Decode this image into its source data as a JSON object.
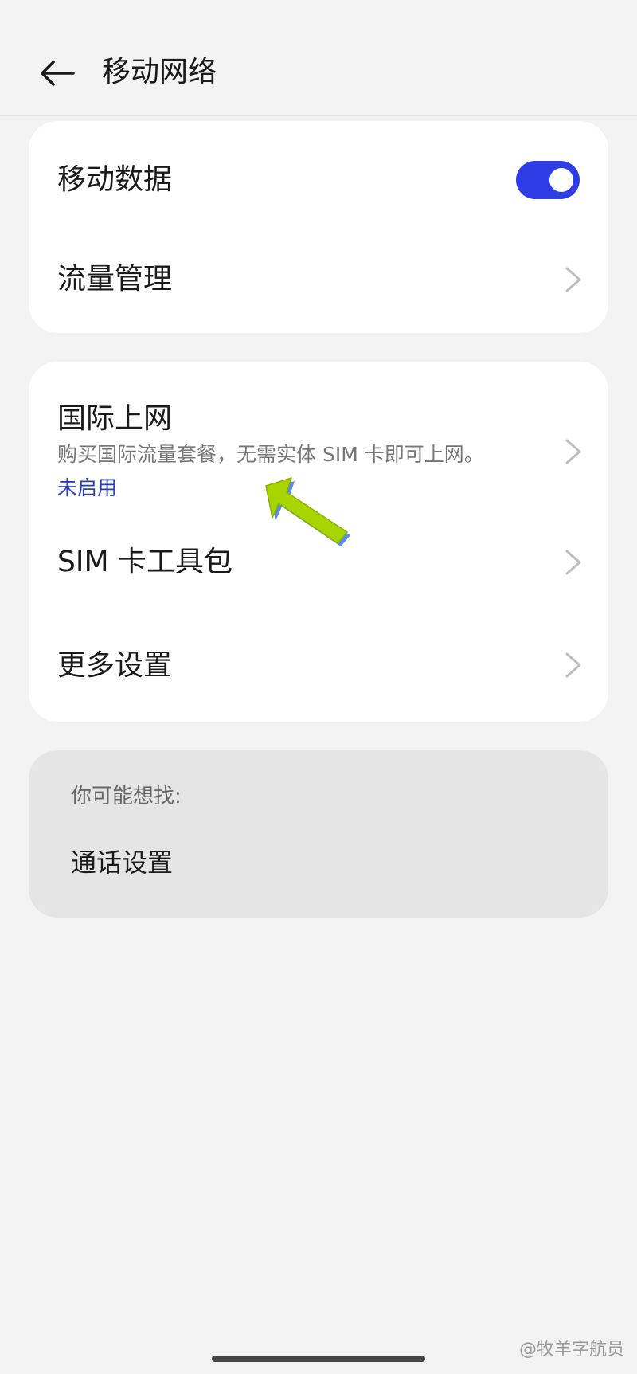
{
  "header": {
    "title": "移动网络"
  },
  "card1": {
    "mobile_data": {
      "label": "移动数据",
      "toggle_on": true
    },
    "traffic_management": {
      "label": "流量管理"
    }
  },
  "card2": {
    "international": {
      "label": "国际上网",
      "description": "购买国际流量套餐，无需实体 SIM 卡即可上网。",
      "status": "未启用"
    },
    "sim_toolkit": {
      "label": "SIM 卡工具包"
    },
    "more_settings": {
      "label": "更多设置"
    }
  },
  "suggestions": {
    "title": "你可能想找:",
    "items": [
      {
        "label": "通话设置"
      }
    ]
  },
  "watermark": "@牧羊字航员",
  "colors": {
    "background": "#f3f3f3",
    "card": "#ffffff",
    "suggest_card": "#e5e5e5",
    "accent": "#2f3de6",
    "status_link": "#2c3fbf",
    "annotation_arrow": "#a8d400"
  },
  "icons": {
    "back": "arrow-left-icon",
    "chevron": "chevron-right-icon",
    "annotation": "annotation-arrow-icon"
  }
}
